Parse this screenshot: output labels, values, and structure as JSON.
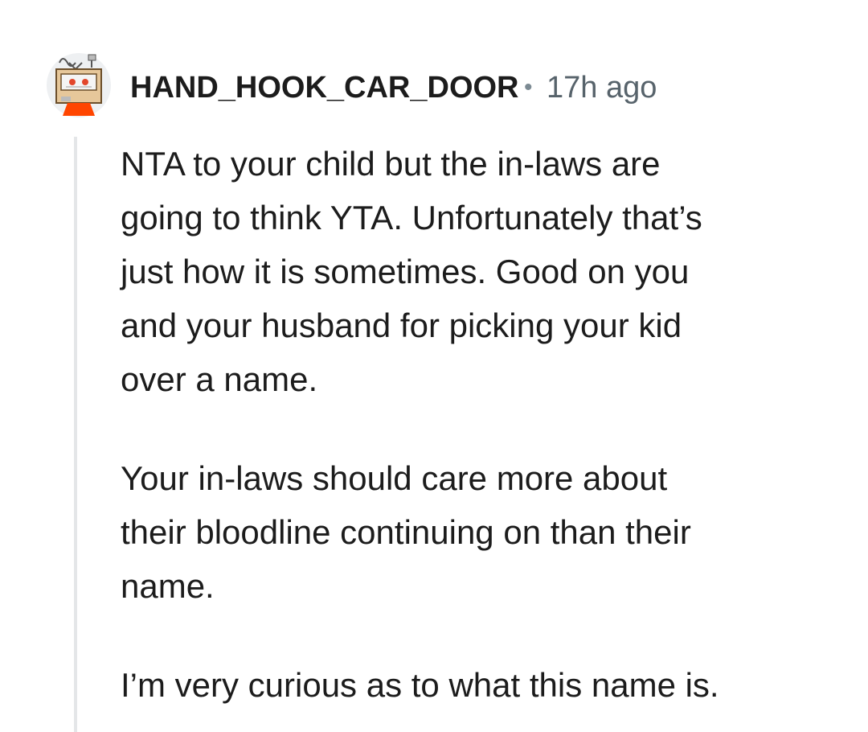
{
  "comment": {
    "author": "HAND_HOOK_CAR_DOOR",
    "separator": "•",
    "timestamp": "17h ago",
    "avatar_icon": "snoo-robot-box-avatar-icon",
    "paragraphs": [
      {
        "lines": [
          "NTA to your child but the in-laws are",
          "going to think YTA. Unfortunately that’s",
          "just how it is sometimes. Good on you",
          "and your husband for picking your kid",
          "over a name."
        ]
      },
      {
        "lines": [
          "Your in-laws should care more about",
          "their bloodline continuing on than their",
          "name."
        ]
      },
      {
        "lines": [
          "I’m very curious as to what this name is."
        ]
      }
    ]
  },
  "colors": {
    "author": "#1c1c1c",
    "timestamp": "#57636b",
    "thread_line": "#e4e6e8",
    "body_text": "#1c1c1c"
  }
}
